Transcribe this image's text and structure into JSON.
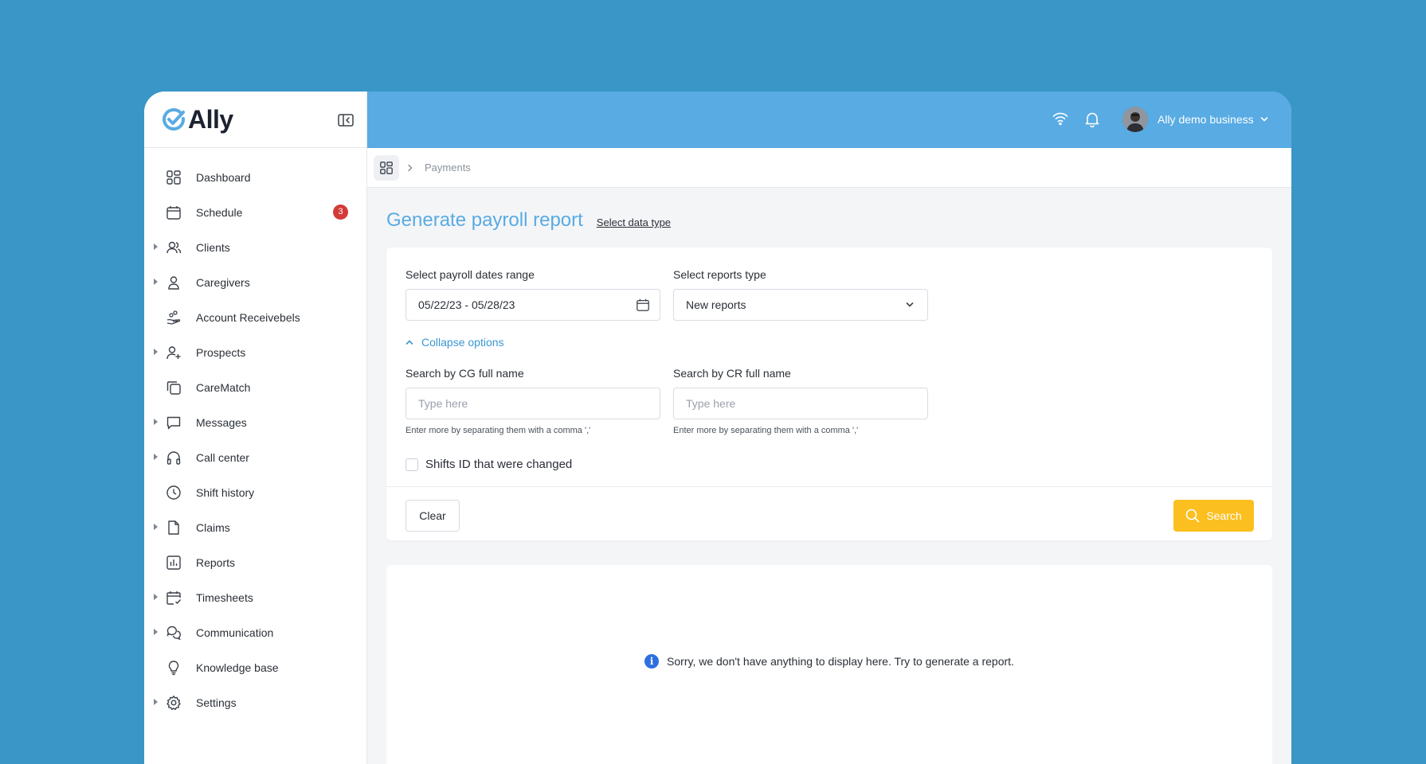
{
  "app": {
    "name": "Ally"
  },
  "sidebar": {
    "items": [
      {
        "label": "Dashboard",
        "icon": "dashboard-icon",
        "expandable": false
      },
      {
        "label": "Schedule",
        "icon": "calendar-icon",
        "expandable": false,
        "badge": "3"
      },
      {
        "label": "Clients",
        "icon": "users-icon",
        "expandable": true
      },
      {
        "label": "Caregivers",
        "icon": "user-icon",
        "expandable": true
      },
      {
        "label": "Account Receivebels",
        "icon": "hand-coins-icon",
        "expandable": false
      },
      {
        "label": "Prospects",
        "icon": "user-plus-icon",
        "expandable": true
      },
      {
        "label": "CareMatch",
        "icon": "copy-icon",
        "expandable": false
      },
      {
        "label": "Messages",
        "icon": "message-icon",
        "expandable": true
      },
      {
        "label": "Call center",
        "icon": "headphones-icon",
        "expandable": true
      },
      {
        "label": "Shift history",
        "icon": "clock-icon",
        "expandable": false
      },
      {
        "label": "Claims",
        "icon": "file-icon",
        "expandable": true
      },
      {
        "label": "Reports",
        "icon": "bar-chart-icon",
        "expandable": false
      },
      {
        "label": "Timesheets",
        "icon": "calendar-check-icon",
        "expandable": true
      },
      {
        "label": "Communication",
        "icon": "chats-icon",
        "expandable": true
      },
      {
        "label": "Knowledge base",
        "icon": "lightbulb-icon",
        "expandable": false
      },
      {
        "label": "Settings",
        "icon": "gear-icon",
        "expandable": true
      }
    ]
  },
  "header": {
    "user_name": "Ally demo business"
  },
  "breadcrumb": {
    "current": "Payments"
  },
  "page": {
    "title": "Generate payroll report",
    "data_type_link": "Select data type"
  },
  "form": {
    "dates_label": "Select payroll dates range",
    "dates_value": "05/22/23 - 05/28/23",
    "reports_type_label": "Select reports type",
    "reports_type_value": "New reports",
    "collapse_label": "Collapse options",
    "cg_label": "Search by CG full name",
    "cg_placeholder": "Type here",
    "cg_hint": "Enter more by separating them with a comma ','",
    "cr_label": "Search by CR full name",
    "cr_placeholder": "Type here",
    "cr_hint": "Enter more by separating them with a comma ','",
    "checkbox_label": "Shifts ID that were changed",
    "clear_label": "Clear",
    "search_label": "Search"
  },
  "empty_state": {
    "message": "Sorry, we don't have anything to display here. Try to generate a report."
  },
  "colors": {
    "background": "#3a96c6",
    "header": "#58abe3",
    "accent_button": "#fbbf1f",
    "badge": "#d33b37",
    "title": "#58abe3"
  }
}
